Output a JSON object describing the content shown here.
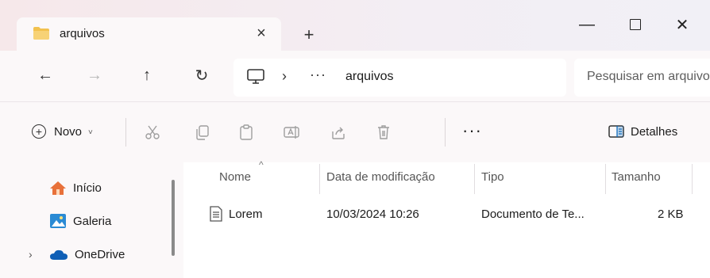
{
  "tab": {
    "title": "arquivos",
    "close": "×",
    "new_tab": "+"
  },
  "window_controls": {
    "minimize": "—",
    "maximize": "",
    "close": "✕"
  },
  "nav": {
    "back": "←",
    "forward": "→",
    "up": "↑",
    "refresh": "↻"
  },
  "address": {
    "separator": "›",
    "overflow": "···",
    "folder": "arquivos"
  },
  "search": {
    "placeholder": "Pesquisar em arquivos"
  },
  "toolbar": {
    "new_label": "Novo",
    "new_chevron": "˅",
    "more": "···",
    "details_label": "Detalhes"
  },
  "sidebar": {
    "items": [
      {
        "label": "Início",
        "icon": "home-icon"
      },
      {
        "label": "Galeria",
        "icon": "gallery-icon"
      },
      {
        "label": "OneDrive",
        "icon": "onedrive-icon",
        "expander": "›"
      }
    ]
  },
  "columns": {
    "name": "Nome",
    "modified": "Data de modificação",
    "type": "Tipo",
    "size": "Tamanho",
    "sort_caret": "^"
  },
  "files": [
    {
      "name": "Lorem",
      "modified": "10/03/2024 10:26",
      "type": "Documento de Te...",
      "size": "2 KB"
    }
  ],
  "colors": {
    "folder": "#f2c14e",
    "accent_blue": "#0f6cbd",
    "home_orange": "#e8713a",
    "gallery_blue": "#2a8ad4",
    "onedrive_blue": "#0f5fb6"
  }
}
